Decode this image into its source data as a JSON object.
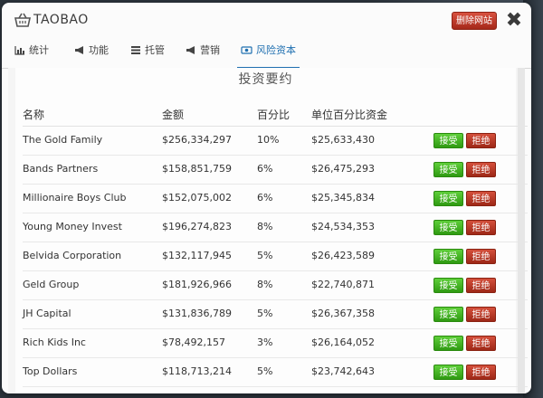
{
  "app": {
    "title": "TAOBAO",
    "delete_label": "删除网站",
    "close_symbol": "✖"
  },
  "tabs": [
    {
      "label": "统计",
      "icon": "bar-chart-icon"
    },
    {
      "label": "功能",
      "icon": "megaphone-icon"
    },
    {
      "label": "托管",
      "icon": "server-icon"
    },
    {
      "label": "营销",
      "icon": "megaphone-icon"
    },
    {
      "label": "风险资本",
      "icon": "money-icon",
      "active": true
    }
  ],
  "section_title": "投资要约",
  "columns": [
    "名称",
    "金额",
    "百分比",
    "单位百分比资金"
  ],
  "offers": [
    {
      "name": "The Gold Family",
      "amount": "$256,334,297",
      "percent": "10%",
      "per_percent": "$25,633,430"
    },
    {
      "name": "Bands Partners",
      "amount": "$158,851,759",
      "percent": "6%",
      "per_percent": "$26,475,293"
    },
    {
      "name": "Millionaire Boys Club",
      "amount": "$152,075,002",
      "percent": "6%",
      "per_percent": "$25,345,834"
    },
    {
      "name": "Young Money Invest",
      "amount": "$196,274,823",
      "percent": "8%",
      "per_percent": "$24,534,353"
    },
    {
      "name": "Belvida Corporation",
      "amount": "$132,117,945",
      "percent": "5%",
      "per_percent": "$26,423,589"
    },
    {
      "name": "Geld Group",
      "amount": "$181,926,966",
      "percent": "8%",
      "per_percent": "$22,740,871"
    },
    {
      "name": "JH Capital",
      "amount": "$131,836,789",
      "percent": "5%",
      "per_percent": "$26,367,358"
    },
    {
      "name": "Rich Kids Inc",
      "amount": "$78,492,157",
      "percent": "3%",
      "per_percent": "$26,164,052"
    },
    {
      "name": "Top Dollars",
      "amount": "$118,713,214",
      "percent": "5%",
      "per_percent": "$23,742,643"
    }
  ],
  "buttons": {
    "accept": "接受",
    "reject": "拒绝"
  },
  "colors": {
    "accent": "#1f6fb0",
    "accept": "#3cb01c",
    "reject": "#b8321f"
  }
}
